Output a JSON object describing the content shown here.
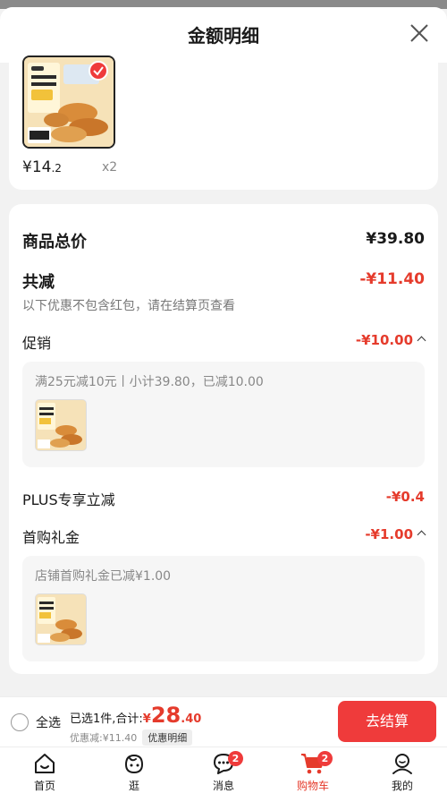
{
  "sheet": {
    "title": "金额明细"
  },
  "item": {
    "price_main": "¥14",
    "price_decimal": ".2",
    "quantity": "x2"
  },
  "summary": {
    "goods_total_label": "商品总价",
    "goods_total_value": "¥39.80",
    "total_discount_label": "共减",
    "total_discount_value": "-¥11.40",
    "discount_note": "以下优惠不包含红包，请在结算页查看",
    "promo_label": "促销",
    "promo_value": "-¥10.00",
    "promo_detail": "满25元减10元丨小计39.80，已减10.00",
    "plus_label": "PLUS专享立减",
    "plus_value": "-¥0.4",
    "first_gift_label": "首购礼金",
    "first_gift_value": "-¥1.00",
    "first_gift_detail": "店铺首购礼金已减¥1.00"
  },
  "bottom_bar": {
    "select_all_label": "全选",
    "selected_prefix": "已选1件,合计:",
    "currency": "¥",
    "total_int": "28",
    "total_dec": ".40",
    "discount_text": "优惠减:¥11.40",
    "detail_pill": "优惠明细",
    "checkout_label": "去结算"
  },
  "tabs": [
    {
      "label": "首页",
      "icon": "home-icon"
    },
    {
      "label": "逛",
      "icon": "browse-icon"
    },
    {
      "label": "消息",
      "icon": "message-icon",
      "badge": "2"
    },
    {
      "label": "购物车",
      "icon": "cart-icon",
      "badge": "2",
      "active": true
    },
    {
      "label": "我的",
      "icon": "profile-icon"
    }
  ],
  "colors": {
    "accent_red": "#e53b2c",
    "button_red": "#ef3b3b"
  }
}
